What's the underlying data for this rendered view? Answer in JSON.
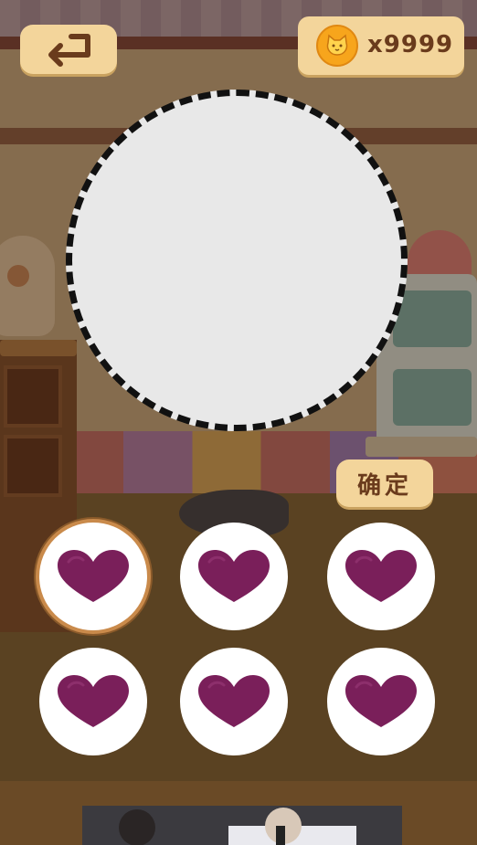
{
  "header": {
    "back_icon": "back-arrow-icon",
    "coin_icon": "cat-coin-icon",
    "coin_count": "x9999"
  },
  "main": {
    "confirm_label": "确定"
  },
  "choices": {
    "icon": "heart-icon",
    "heart_color": "#7a1f5a",
    "selected_index": 0,
    "items": [
      {
        "icon": "heart-icon"
      },
      {
        "icon": "heart-icon"
      },
      {
        "icon": "heart-icon"
      },
      {
        "icon": "heart-icon"
      },
      {
        "icon": "heart-icon"
      },
      {
        "icon": "heart-icon"
      }
    ]
  },
  "colors": {
    "button_bg": "#f3d59b",
    "button_text": "#6a3b1c",
    "coin": "#f7a51c"
  }
}
